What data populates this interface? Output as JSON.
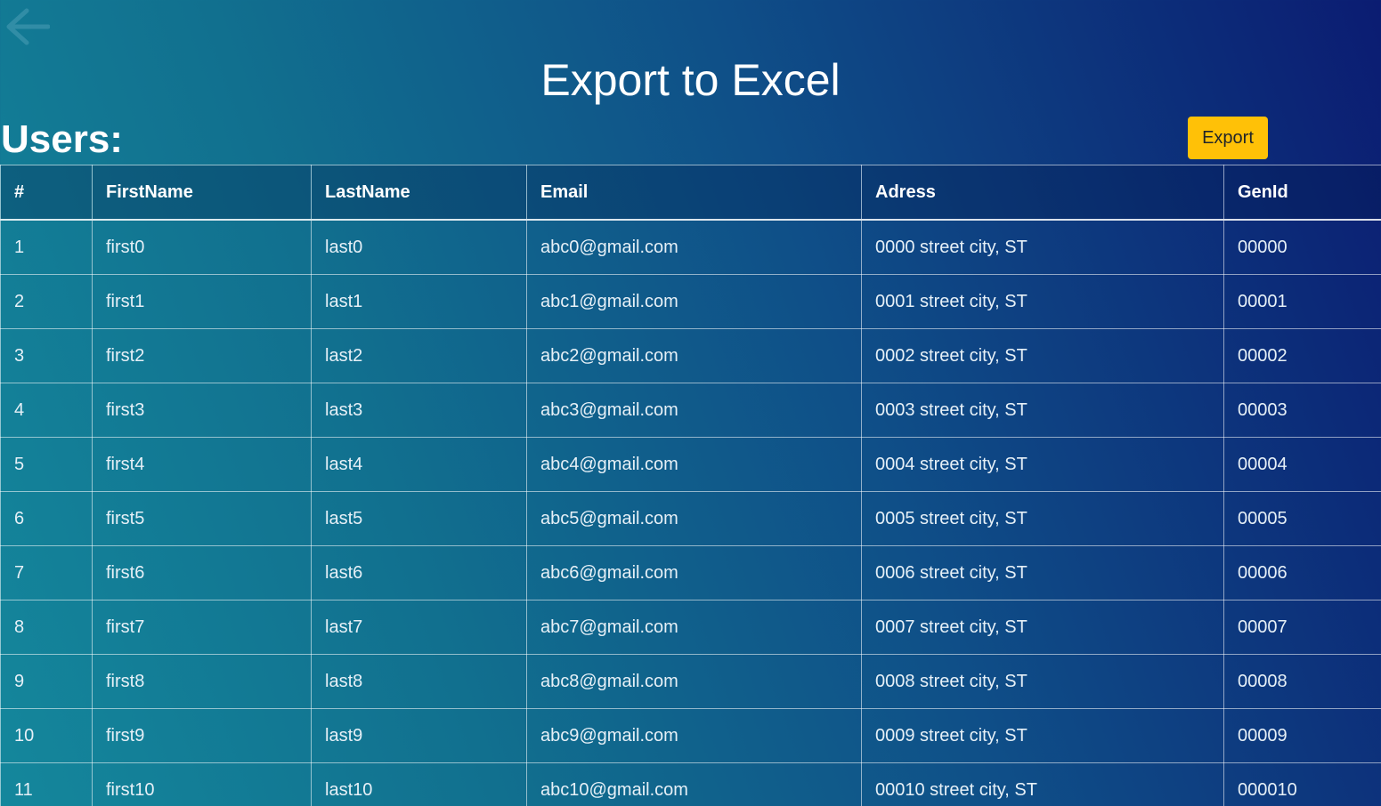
{
  "header": {
    "title": "Export to Excel",
    "back_icon": "arrow-left-icon"
  },
  "users": {
    "heading": "Users:",
    "export_label": "Export",
    "export_color": "#ffc107",
    "columns": [
      "#",
      "FirstName",
      "LastName",
      "Email",
      "Adress",
      "GenId"
    ],
    "rows": [
      [
        "1",
        "first0",
        "last0",
        "abc0@gmail.com",
        "0000 street city, ST",
        "00000"
      ],
      [
        "2",
        "first1",
        "last1",
        "abc1@gmail.com",
        "0001 street city, ST",
        "00001"
      ],
      [
        "3",
        "first2",
        "last2",
        "abc2@gmail.com",
        "0002 street city, ST",
        "00002"
      ],
      [
        "4",
        "first3",
        "last3",
        "abc3@gmail.com",
        "0003 street city, ST",
        "00003"
      ],
      [
        "5",
        "first4",
        "last4",
        "abc4@gmail.com",
        "0004 street city, ST",
        "00004"
      ],
      [
        "6",
        "first5",
        "last5",
        "abc5@gmail.com",
        "0005 street city, ST",
        "00005"
      ],
      [
        "7",
        "first6",
        "last6",
        "abc6@gmail.com",
        "0006 street city, ST",
        "00006"
      ],
      [
        "8",
        "first7",
        "last7",
        "abc7@gmail.com",
        "0007 street city, ST",
        "00007"
      ],
      [
        "9",
        "first8",
        "last8",
        "abc8@gmail.com",
        "0008 street city, ST",
        "00008"
      ],
      [
        "10",
        "first9",
        "last9",
        "abc9@gmail.com",
        "0009 street city, ST",
        "00009"
      ],
      [
        "11",
        "first10",
        "last10",
        "abc10@gmail.com",
        "00010 street city, ST",
        "000010"
      ]
    ]
  }
}
